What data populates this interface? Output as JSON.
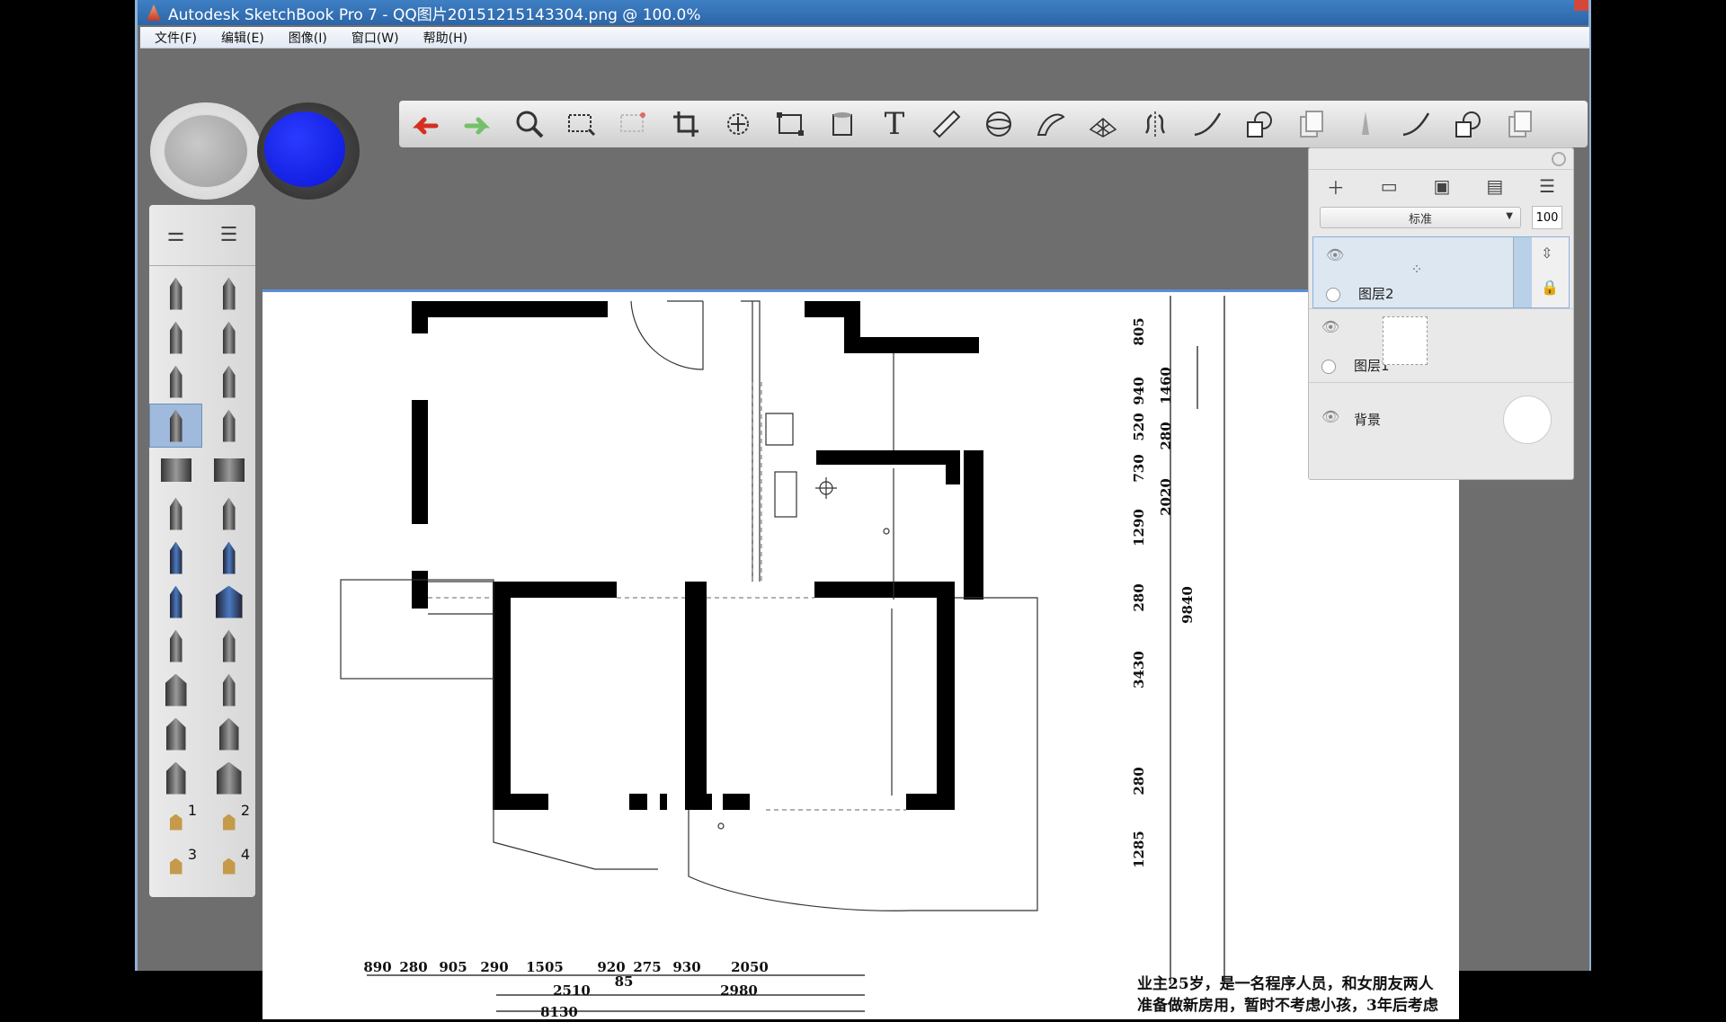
{
  "window": {
    "title": "Autodesk SketchBook Pro 7 - QQ图片20151215143304.png @ 100.0%"
  },
  "menu": [
    "文件(F)",
    "编辑(E)",
    "图像(I)",
    "窗口(W)",
    "帮助(H)"
  ],
  "colors": {
    "primary": "#0a14d6",
    "secondary": "#b5b5b5",
    "accent": "#5b8fd8"
  },
  "toolbar": {
    "tools": [
      "undo-icon",
      "redo-icon",
      "zoom-icon",
      "select-rect-icon",
      "select-lasso-icon",
      "crop-icon",
      "transform-icon",
      "distort-icon",
      "fill-icon",
      "text-icon",
      "ruler-icon",
      "ellipse-guide-icon",
      "french-curve-icon",
      "perspective-icon",
      "symmetry-icon",
      "stroke-icon",
      "shape-icon",
      "copy-layer-icon",
      "brush-icon",
      "curve-icon",
      "shape2-icon",
      "paste-icon"
    ],
    "text_tool_label": "T"
  },
  "brushes": {
    "slot_numbers": [
      "1",
      "2",
      "3",
      "4"
    ]
  },
  "layers": {
    "blend_mode": "标准",
    "opacity": "100",
    "items": [
      {
        "name": "图层2"
      },
      {
        "name": "图层1"
      },
      {
        "name": "背景"
      }
    ]
  },
  "plan": {
    "right_dims": [
      "805",
      "940",
      "520",
      "730",
      "1290",
      "280",
      "3430",
      "280",
      "1285"
    ],
    "right_dims_mid": [
      "1460",
      "280",
      "2020"
    ],
    "total_height": "9840",
    "bottom_dims": [
      "890",
      "280",
      "905",
      "290",
      "1505",
      "920",
      "275",
      "930",
      "2050"
    ],
    "bottom_dims_mid": [
      "2510",
      "85",
      "2980"
    ],
    "total_width": "8130",
    "note_lines": [
      "业主25岁，是一名程序人员，和女朋友两人",
      "准备做新房用，暂时不考虑小孩，3年后考虑"
    ]
  }
}
